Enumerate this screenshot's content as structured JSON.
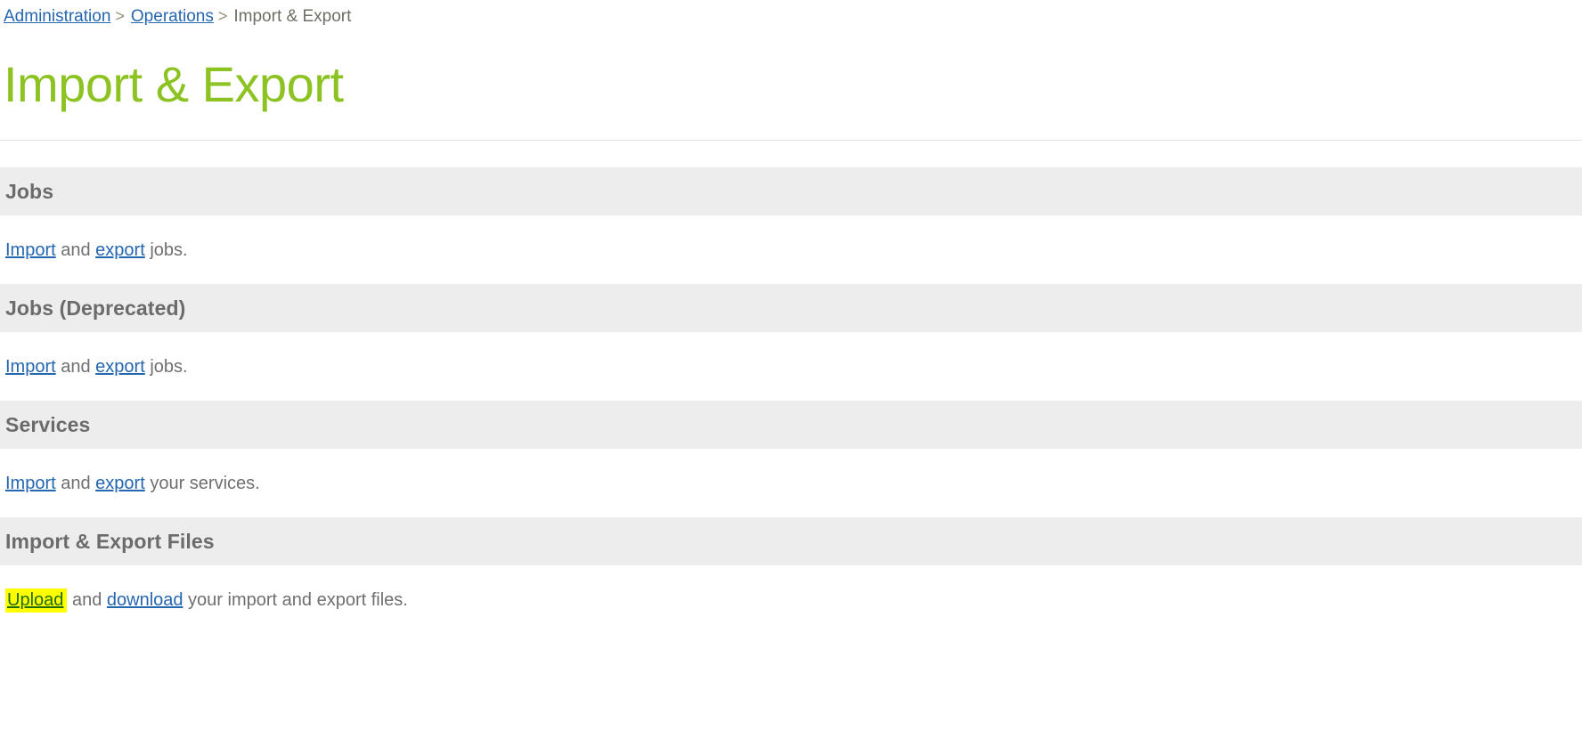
{
  "breadcrumb": {
    "items": [
      {
        "label": "Administration",
        "link": true
      },
      {
        "label": "Operations",
        "link": true
      },
      {
        "label": "Import & Export",
        "link": false
      }
    ],
    "separator": ">"
  },
  "page": {
    "title": "Import & Export",
    "title_color": "#8cc322",
    "link_color": "#2566b0",
    "header_band_color": "#ededed",
    "highlight_color": "#ffff00",
    "highlight_text_color": "#1f6b10"
  },
  "sections": [
    {
      "header": "Jobs",
      "body": {
        "parts": [
          {
            "text": "Import",
            "type": "link"
          },
          {
            "text": " and ",
            "type": "text"
          },
          {
            "text": "export",
            "type": "link"
          },
          {
            "text": " jobs.",
            "type": "text"
          }
        ]
      }
    },
    {
      "header": "Jobs (Deprecated)",
      "body": {
        "parts": [
          {
            "text": "Import",
            "type": "link"
          },
          {
            "text": " and ",
            "type": "text"
          },
          {
            "text": "export",
            "type": "link"
          },
          {
            "text": " jobs.",
            "type": "text"
          }
        ]
      }
    },
    {
      "header": "Services",
      "body": {
        "parts": [
          {
            "text": "Import",
            "type": "link"
          },
          {
            "text": " and ",
            "type": "text"
          },
          {
            "text": "export",
            "type": "link"
          },
          {
            "text": " your services.",
            "type": "text"
          }
        ]
      }
    },
    {
      "header": "Import & Export Files",
      "body": {
        "parts": [
          {
            "text": "Upload",
            "type": "link-highlighted"
          },
          {
            "text": " and ",
            "type": "text"
          },
          {
            "text": "download",
            "type": "link"
          },
          {
            "text": " your import and export files.",
            "type": "text"
          }
        ]
      }
    }
  ]
}
